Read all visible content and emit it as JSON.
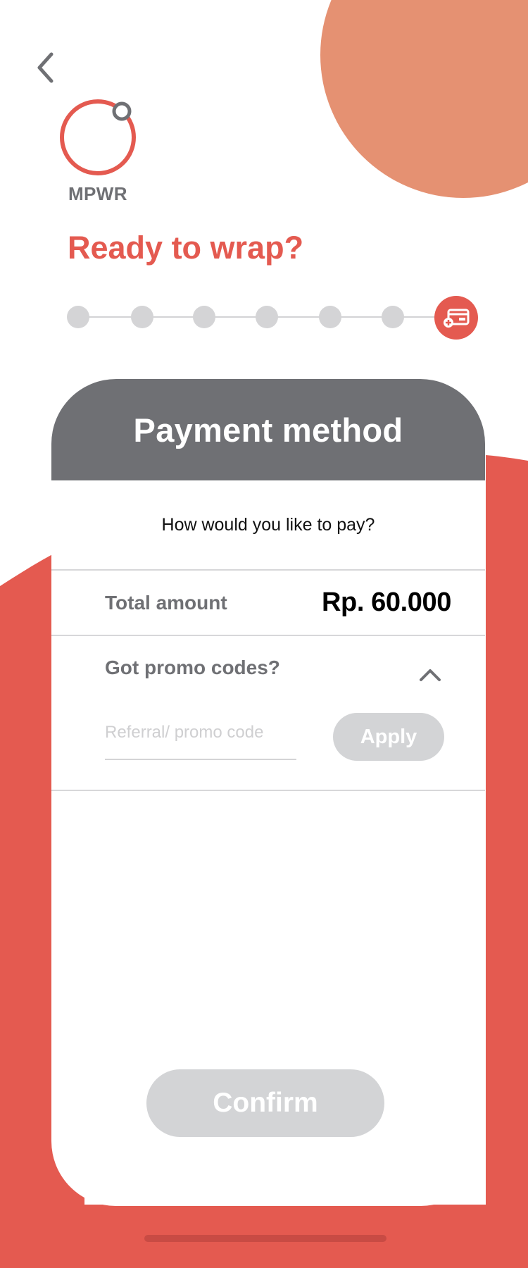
{
  "colors": {
    "accent": "#e45a50",
    "peach": "#e59172",
    "header": "#6f7074",
    "disabled": "#d3d4d6"
  },
  "header": {
    "back_icon": "chevron-left-icon",
    "brand_name": "MPWR",
    "title": "Ready to wrap?"
  },
  "stepper": {
    "total_steps": 7,
    "current_step": 7,
    "current_icon": "credit-card-add-icon"
  },
  "card": {
    "title": "Payment method",
    "subtitle": "How would you like to pay?",
    "total": {
      "label": "Total amount",
      "value": "Rp. 60.000"
    },
    "promo": {
      "label": "Got promo codes?",
      "toggle_icon": "chevron-up-icon",
      "input_placeholder": "Referral/ promo code",
      "input_value": "",
      "apply_label": "Apply"
    },
    "confirm_label": "Confirm"
  }
}
